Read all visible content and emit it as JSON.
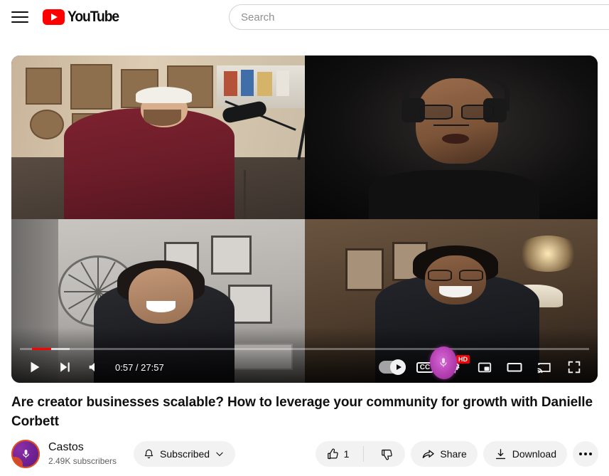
{
  "header": {
    "menu_icon": "hamburger-menu-icon",
    "logo_text": "YouTube",
    "logo_icon": "youtube-play-icon",
    "search": {
      "placeholder": "Search",
      "value": ""
    }
  },
  "player": {
    "state": "paused",
    "time_display": "0:57 / 27:57",
    "current_time": "0:57",
    "duration": "27:57",
    "progress_percent": 3.4,
    "buffer_percent": 6.6,
    "layout": "2x2-grid",
    "participants": [
      {
        "position": "top-left",
        "description": "man in maroon hoodie with white cap at microphone, art prints on wall"
      },
      {
        "position": "top-right",
        "description": "man with glasses and headphones in dark room"
      },
      {
        "position": "bottom-left",
        "description": "woman laughing in front of gray wall with wire clock"
      },
      {
        "position": "bottom-right",
        "description": "woman with glasses smiling, warm lamp lighting"
      }
    ],
    "controls": {
      "play_label": "Play",
      "next_label": "Next",
      "volume_label": "Mute",
      "autoplay_label": "Autoplay is on",
      "autoplay_on": true,
      "subtitles_label": "CC",
      "settings_label": "Settings",
      "quality_badge": "HD",
      "miniplayer_label": "Miniplayer",
      "theater_label": "Theater mode",
      "cast_label": "Play on TV",
      "fullscreen_label": "Full screen",
      "cursor_badge_icon": "microphone-cursor-icon"
    },
    "accent_color": "#ff0000"
  },
  "video": {
    "title": "Are creator businesses scalable? How to leverage your community for growth with Danielle Corbett"
  },
  "channel": {
    "name": "Castos",
    "subscribers": "2.49K subscribers",
    "avatar_icon": "microphone-avatar-icon",
    "avatar_color": "#6b2090",
    "avatar_accent": "#e2501f",
    "subscribe_button": {
      "label": "Subscribed",
      "bell_icon": "bell-icon",
      "chevron_icon": "chevron-down-icon",
      "subscribed": true
    }
  },
  "actions": {
    "like": {
      "label": "Like",
      "count": "1",
      "icon": "thumbs-up-icon"
    },
    "dislike": {
      "label": "Dislike",
      "icon": "thumbs-down-icon"
    },
    "share": {
      "label": "Share",
      "icon": "share-arrow-icon"
    },
    "download": {
      "label": "Download",
      "icon": "download-arrow-icon"
    },
    "more": {
      "label": "More actions",
      "icon": "more-horizontal-icon"
    }
  }
}
